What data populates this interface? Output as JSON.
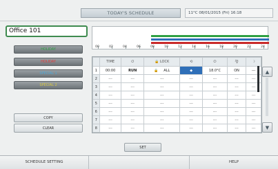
{
  "header": {
    "title": "TODAY'S SCHEDULE",
    "datetime": "11°C  08/01/2015 (Fri) 16:18"
  },
  "name_field": {
    "value": "Office 101"
  },
  "timeline": {
    "hours": [
      "00",
      "02",
      "04",
      "06",
      "08",
      "10",
      "12",
      "14",
      "16",
      "18",
      "20",
      "22",
      "24"
    ],
    "bars": [
      {
        "color": "#2ea043",
        "from": 8,
        "to": 24
      },
      {
        "color": "#2f6fb8",
        "from": 8,
        "to": 24
      },
      {
        "color": "#c92a2a",
        "from": 8,
        "to": 24
      }
    ]
  },
  "left_buttons": {
    "holiday_bar": "HOLIDAY",
    "holiday": "HOLIDAY",
    "special1": "SPECIAL 1",
    "special2": "SPECIAL 2",
    "copy": "COPY",
    "clear": "CLEAR"
  },
  "table": {
    "headers": [
      "",
      "TIME",
      "⏻",
      "🔒 LOCK",
      "⟲",
      "⏻",
      "🌪",
      "☽"
    ],
    "rows": [
      {
        "n": "1",
        "time": "00:00",
        "run": "RUN",
        "lock_icon": "🔒",
        "lock": "ALL",
        "mode": "◆",
        "temp": "18.0°C",
        "fan": "ON",
        "extra": "---"
      },
      {
        "n": "2",
        "time": "---",
        "run": "---",
        "lock_icon": "",
        "lock": "---",
        "mode": "---",
        "temp": "---",
        "fan": "---",
        "extra": "---"
      },
      {
        "n": "3",
        "time": "---",
        "run": "---",
        "lock_icon": "",
        "lock": "---",
        "mode": "---",
        "temp": "---",
        "fan": "---",
        "extra": "---"
      },
      {
        "n": "4",
        "time": "---",
        "run": "---",
        "lock_icon": "",
        "lock": "---",
        "mode": "---",
        "temp": "---",
        "fan": "---",
        "extra": "---"
      },
      {
        "n": "5",
        "time": "---",
        "run": "---",
        "lock_icon": "",
        "lock": "---",
        "mode": "---",
        "temp": "---",
        "fan": "---",
        "extra": "---"
      },
      {
        "n": "6",
        "time": "---",
        "run": "---",
        "lock_icon": "",
        "lock": "---",
        "mode": "---",
        "temp": "---",
        "fan": "---",
        "extra": "---"
      },
      {
        "n": "7",
        "time": "---",
        "run": "---",
        "lock_icon": "",
        "lock": "---",
        "mode": "---",
        "temp": "---",
        "fan": "---",
        "extra": "---"
      },
      {
        "n": "8",
        "time": "---",
        "run": "---",
        "lock_icon": "",
        "lock": "---",
        "mode": "---",
        "temp": "---",
        "fan": "---",
        "extra": "---"
      }
    ]
  },
  "scroll": {
    "up": "▲",
    "down": "▼"
  },
  "actions": {
    "set": "SET"
  },
  "footer": {
    "schedule_setting": "SCHEDULE SETTING",
    "help": "HELP"
  },
  "colors": {
    "holiday_text": "#e03b3b",
    "special1_text": "#4aa8d8",
    "special2_text": "#d8c840",
    "holiday_bar_text": "#2ea043"
  }
}
